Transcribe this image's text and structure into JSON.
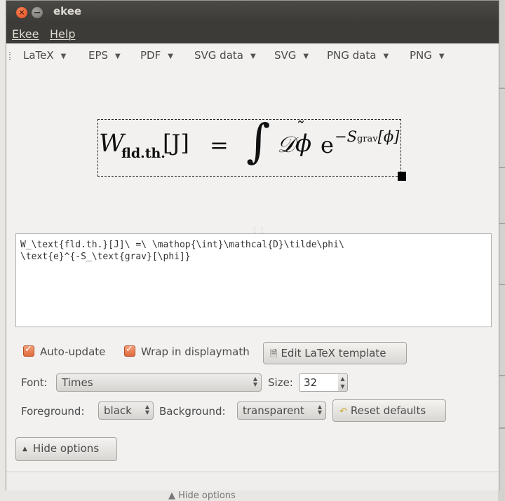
{
  "window": {
    "title": "ekee"
  },
  "menu": [
    {
      "label": "Ekee"
    },
    {
      "label": "Help"
    }
  ],
  "toolbar": [
    {
      "label": "LaTeX"
    },
    {
      "label": "EPS"
    },
    {
      "label": "PDF"
    },
    {
      "label": "SVG data"
    },
    {
      "label": "SVG"
    },
    {
      "label": "PNG data"
    },
    {
      "label": "PNG"
    }
  ],
  "formula": {
    "W": "W",
    "subscript": "fld.th.",
    "bracket": "[J]",
    "equals": "=",
    "integral": "∫",
    "D": "𝒟",
    "tilde": "˜",
    "phi": "ϕ",
    "e": "e",
    "exp_a": "−S",
    "exp_sub": "grav",
    "exp_b": "[ϕ]"
  },
  "editor": {
    "line1": "W_\\text{fld.th.}[J]\\ =\\ \\mathop{\\int}\\mathcal{D}\\tilde\\phi\\",
    "line2": "\\text{e}^{-S_\\text{grav}[\\phi]}"
  },
  "options": {
    "auto_update": {
      "label": "Auto-update",
      "checked": true
    },
    "wrap_displaymath": {
      "label": "Wrap in displaymath",
      "checked": true
    },
    "edit_template_label": "Edit LaTeX template",
    "font_label": "Font:",
    "font_value": "Times",
    "size_label": "Size:",
    "size_value": "32",
    "foreground_label": "Foreground:",
    "foreground_value": "black",
    "background_label": "Background:",
    "background_value": "transparent",
    "reset_label": "Reset defaults",
    "hide_options_label": "Hide options"
  },
  "background_app": {
    "hide_options_label": "Hide options"
  },
  "colors": {
    "titlebar": "#3b3a37",
    "accent_checkbox": "#e06a3c",
    "window_bg": "#f2f1f0"
  }
}
